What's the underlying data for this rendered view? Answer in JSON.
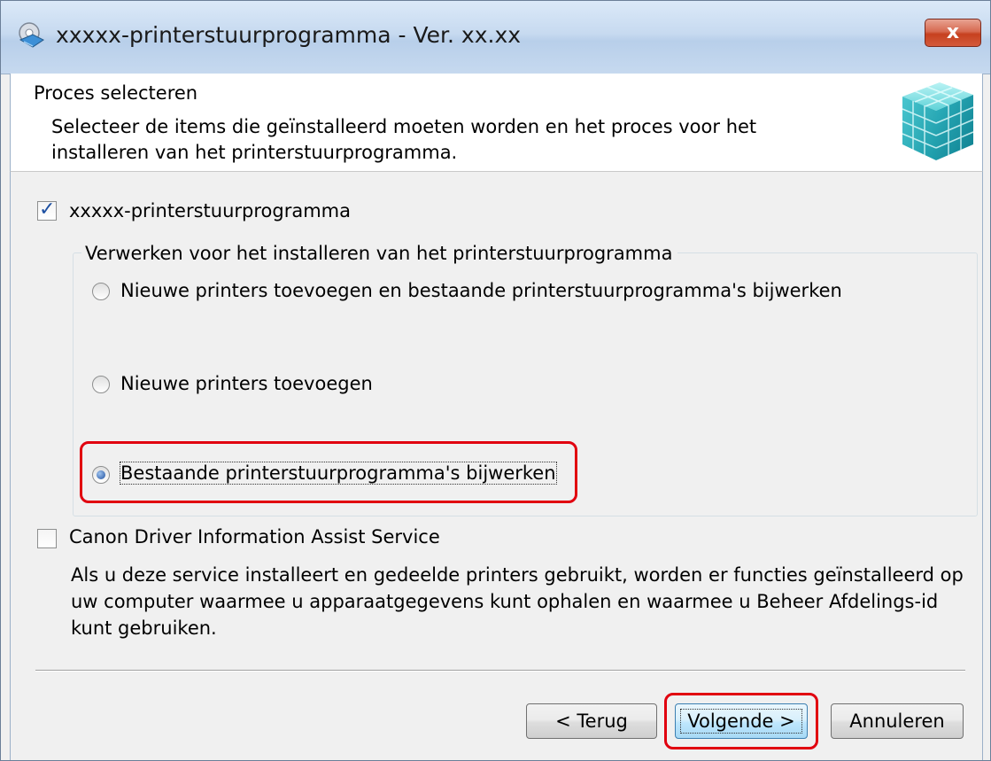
{
  "window": {
    "title": "xxxxx-printerstuurprogramma - Ver. xx.xx",
    "close_label": "x"
  },
  "header": {
    "title": "Proces selecteren",
    "description": "Selecteer de items die geïnstalleerd moeten worden en het proces voor het installeren van het printerstuurprogramma."
  },
  "driver_option": {
    "label": "xxxxx-printerstuurprogramma",
    "checked": true
  },
  "install_process_group": {
    "title": "Verwerken voor het installeren van het printerstuurprogramma",
    "options": [
      {
        "label": "Nieuwe printers toevoegen en bestaande printerstuurprogramma's bijwerken",
        "selected": false
      },
      {
        "label": "Nieuwe printers toevoegen",
        "selected": false
      },
      {
        "label": "Bestaande printerstuurprogramma's bijwerken",
        "selected": true
      }
    ]
  },
  "assist_service": {
    "label": "Canon Driver Information Assist Service",
    "checked": false,
    "description": "Als u deze service installeert en gedeelde printers gebruikt, worden er functies geïnstalleerd op uw computer waarmee u apparaatgegevens kunt ophalen en waarmee u Beheer Afdelings-id kunt gebruiken."
  },
  "buttons": {
    "back": "< Terug",
    "next": "Volgende >",
    "cancel": "Annuleren"
  },
  "colors": {
    "highlight": "#e1000f",
    "accent": "#1d4f9e"
  }
}
